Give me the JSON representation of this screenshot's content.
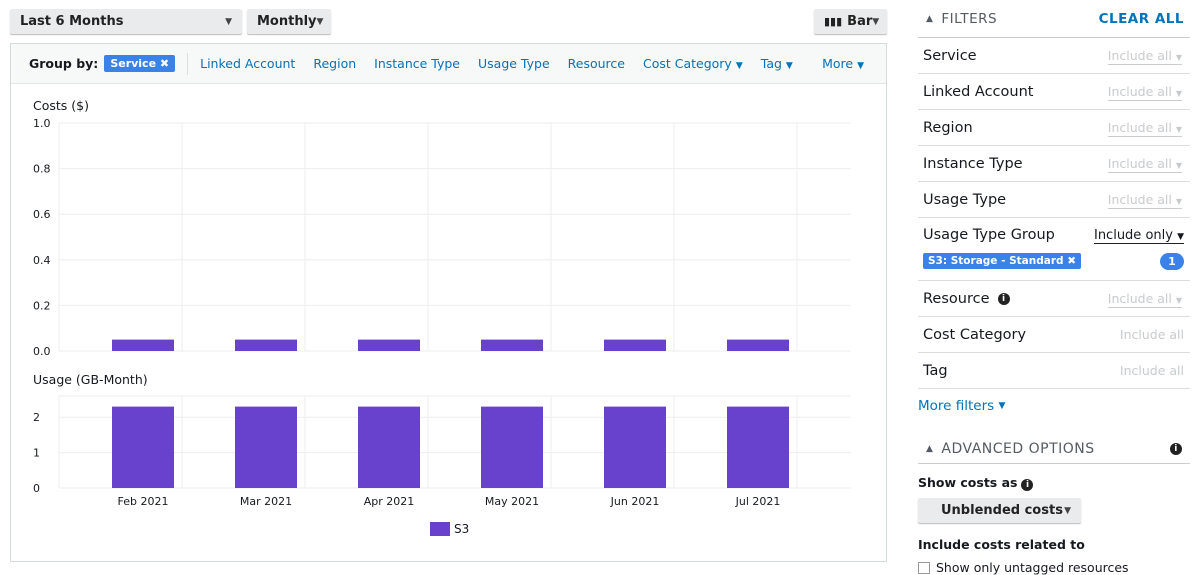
{
  "toolbar": {
    "range": "Last 6 Months",
    "granularity": "Monthly",
    "chart_type": "Bar"
  },
  "group_by": {
    "label": "Group by:",
    "selected": "Service",
    "options": [
      "Linked Account",
      "Region",
      "Instance Type",
      "Usage Type",
      "Resource",
      "Cost Category",
      "Tag"
    ],
    "more": "More"
  },
  "chart_data": [
    {
      "type": "bar",
      "ylabel": "Costs ($)",
      "categories": [
        "Feb 2021",
        "Mar 2021",
        "Apr 2021",
        "May 2021",
        "Jun 2021",
        "Jul 2021"
      ],
      "ylim": [
        0,
        1.0
      ],
      "yticks": [
        "0.0",
        "0.2",
        "0.4",
        "0.6",
        "0.8",
        "1.0"
      ],
      "grid": true,
      "series": [
        {
          "name": "S3",
          "values": [
            0.05,
            0.05,
            0.05,
            0.05,
            0.05,
            0.05
          ],
          "color": "#6842cc"
        }
      ]
    },
    {
      "type": "bar",
      "ylabel": "Usage (GB-Month)",
      "categories": [
        "Feb 2021",
        "Mar 2021",
        "Apr 2021",
        "May 2021",
        "Jun 2021",
        "Jul 2021"
      ],
      "ylim": [
        0,
        2.6
      ],
      "yticks": [
        "0",
        "1",
        "2"
      ],
      "grid": true,
      "legend": "bottom",
      "series": [
        {
          "name": "S3",
          "values": [
            2.3,
            2.3,
            2.3,
            2.3,
            2.3,
            2.3
          ],
          "color": "#6842cc"
        }
      ]
    }
  ],
  "filters": {
    "title": "FILTERS",
    "clear": "CLEAR ALL",
    "rows": [
      {
        "label": "Service",
        "value": "Include all"
      },
      {
        "label": "Linked Account",
        "value": "Include all"
      },
      {
        "label": "Region",
        "value": "Include all"
      },
      {
        "label": "Instance Type",
        "value": "Include all"
      },
      {
        "label": "Usage Type",
        "value": "Include all"
      }
    ],
    "usage_type_group": {
      "label": "Usage Type Group",
      "value": "Include only",
      "chip": "S3: Storage - Standard",
      "count": "1"
    },
    "resource": {
      "label": "Resource",
      "value": "Include all"
    },
    "cost_category": {
      "label": "Cost Category",
      "value": "Include all"
    },
    "tag": {
      "label": "Tag",
      "value": "Include all"
    },
    "more": "More filters"
  },
  "advanced": {
    "title": "ADVANCED OPTIONS",
    "show_costs_as": "Show costs as",
    "cost_type": "Unblended costs",
    "include_related": "Include costs related to",
    "untagged": "Show only untagged resources"
  }
}
